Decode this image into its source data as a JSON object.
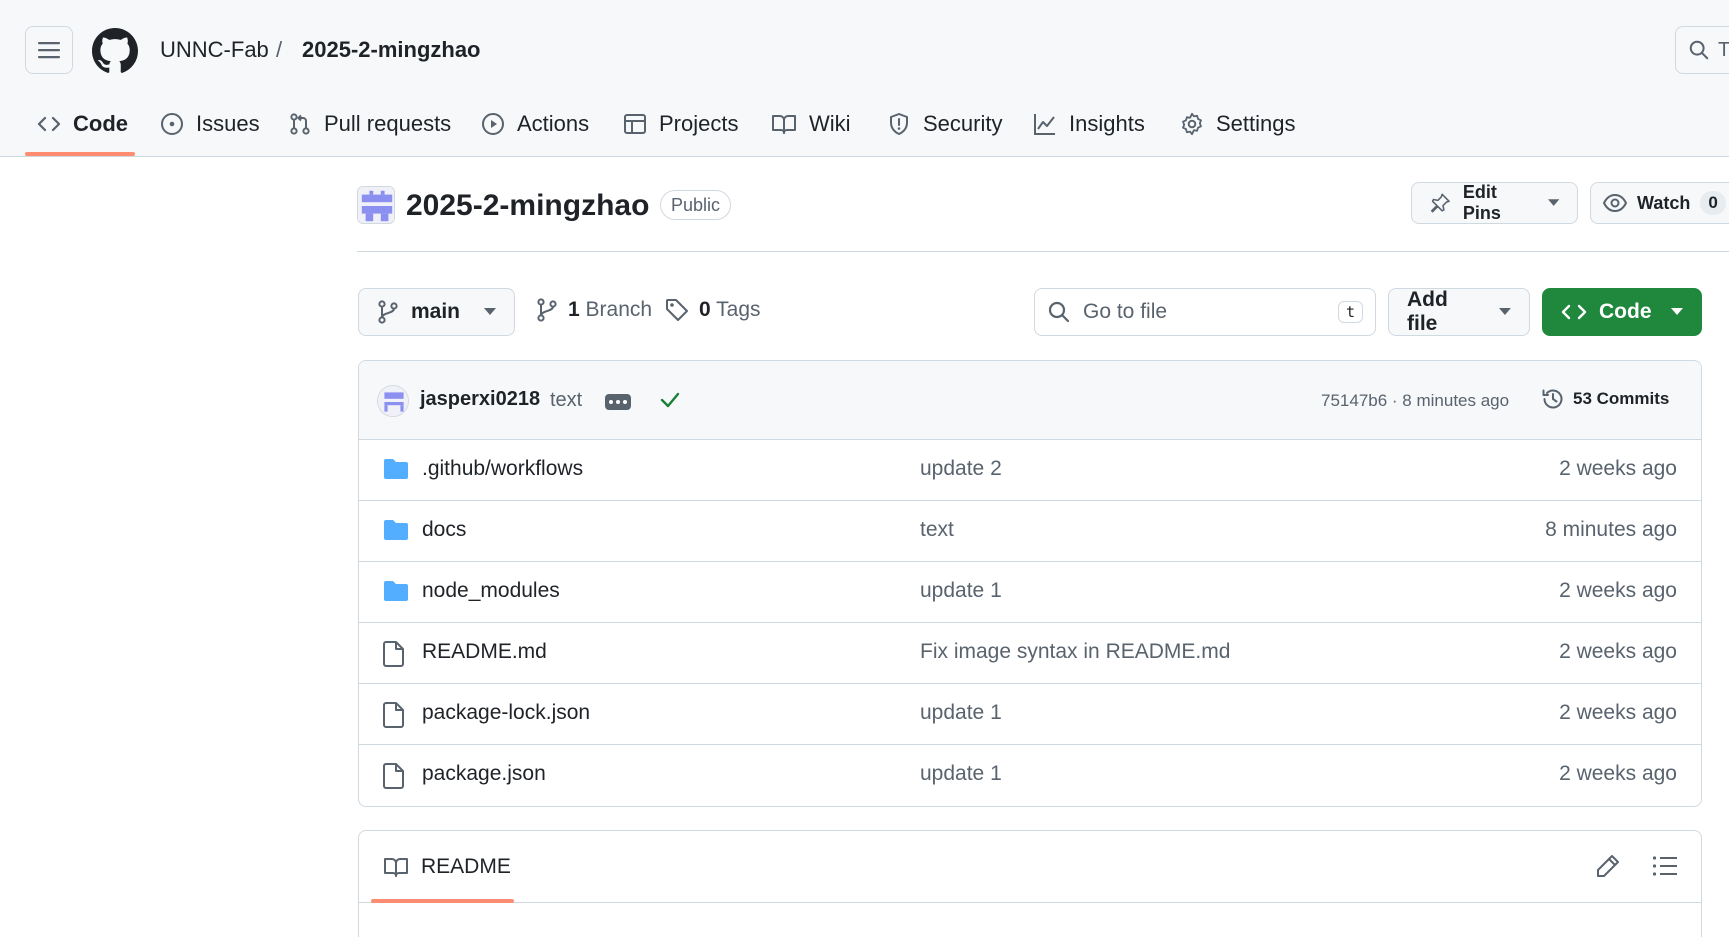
{
  "header": {
    "owner": "UNNC-Fab",
    "separator": "/",
    "repo": "2025-2-mingzhao",
    "search_stub": "T"
  },
  "tabs": [
    {
      "label": "Code",
      "icon": "code-icon",
      "active": true
    },
    {
      "label": "Issues",
      "icon": "issue-icon"
    },
    {
      "label": "Pull requests",
      "icon": "pull-request-icon"
    },
    {
      "label": "Actions",
      "icon": "play-icon"
    },
    {
      "label": "Projects",
      "icon": "table-icon"
    },
    {
      "label": "Wiki",
      "icon": "book-icon"
    },
    {
      "label": "Security",
      "icon": "shield-icon"
    },
    {
      "label": "Insights",
      "icon": "graph-icon"
    },
    {
      "label": "Settings",
      "icon": "gear-icon"
    }
  ],
  "repo": {
    "name": "2025-2-mingzhao",
    "visibility": "Public",
    "edit_pins_label": "Edit Pins",
    "watch_label": "Watch",
    "watch_count": "0"
  },
  "toolbar": {
    "branch": "main",
    "branch_count": "1",
    "branch_label": "Branch",
    "tag_count": "0",
    "tag_label": "Tags",
    "goto_placeholder": "Go to file",
    "goto_shortcut": "t",
    "add_file_label": "Add file",
    "code_label": "Code"
  },
  "latest_commit": {
    "author": "jasperxi0218",
    "message": "text",
    "sha_time": "75147b6 · 8 minutes ago",
    "commits_label": "53 Commits"
  },
  "files": [
    {
      "type": "folder",
      "name": ".github/workflows",
      "message": "update 2",
      "date": "2 weeks ago"
    },
    {
      "type": "folder",
      "name": "docs",
      "message": "text",
      "date": "8 minutes ago"
    },
    {
      "type": "folder",
      "name": "node_modules",
      "message": "update 1",
      "date": "2 weeks ago"
    },
    {
      "type": "file",
      "name": "README.md",
      "message": "Fix image syntax in README.md",
      "date": "2 weeks ago"
    },
    {
      "type": "file",
      "name": "package-lock.json",
      "message": "update 1",
      "date": "2 weeks ago"
    },
    {
      "type": "file",
      "name": "package.json",
      "message": "update 1",
      "date": "2 weeks ago"
    }
  ],
  "readme": {
    "tab_label": "README"
  },
  "colors": {
    "accent_underline": "#fd8c73",
    "primary_green": "#1f883d",
    "folder_blue": "#54aeff",
    "muted_text": "#59636e",
    "border": "#d1d9e0"
  }
}
